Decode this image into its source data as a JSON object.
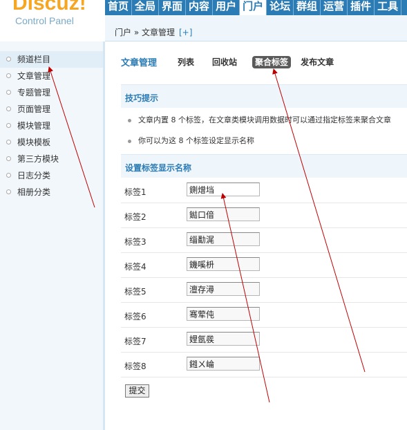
{
  "logo": {
    "brand": "Discuz!",
    "subtitle": "Control Panel"
  },
  "topnav": [
    {
      "label": "首页",
      "active": false
    },
    {
      "label": "全局",
      "active": false
    },
    {
      "label": "界面",
      "active": false
    },
    {
      "label": "内容",
      "active": false
    },
    {
      "label": "用户",
      "active": false
    },
    {
      "label": "门户",
      "active": true
    },
    {
      "label": "论坛",
      "active": false
    },
    {
      "label": "群组",
      "active": false
    },
    {
      "label": "运营",
      "active": false
    },
    {
      "label": "插件",
      "active": false
    },
    {
      "label": "工具",
      "active": false
    }
  ],
  "breadcrumb": {
    "text": "门户 » 文章管理",
    "add": "[+]"
  },
  "sidebar": {
    "items": [
      {
        "label": "频道栏目",
        "active": true
      },
      {
        "label": "文章管理",
        "active": false
      },
      {
        "label": "专题管理",
        "active": false
      },
      {
        "label": "页面管理",
        "active": false
      },
      {
        "label": "模块管理",
        "active": false
      },
      {
        "label": "模块模板",
        "active": false
      },
      {
        "label": "第三方模块",
        "active": false
      },
      {
        "label": "日志分类",
        "active": false
      },
      {
        "label": "相册分类",
        "active": false
      }
    ]
  },
  "subhead": {
    "title": "文章管理",
    "tabs": [
      {
        "label": "列表",
        "active": false
      },
      {
        "label": "回收站",
        "active": false
      },
      {
        "label": "聚合标签",
        "active": true
      },
      {
        "label": "发布文章",
        "active": false
      }
    ]
  },
  "tips": {
    "heading": "技巧提示",
    "items": [
      "文章内置 8 个标签，在文章类模块调用数据时可以通过指定标签来聚合文章",
      "你可以为这 8 个标签设定显示名称"
    ]
  },
  "form": {
    "heading": "设置标签显示名称",
    "rows": [
      {
        "label": "标签1",
        "value": "鍘熷垱"
      },
      {
        "label": "标签2",
        "value": "鐑口偣"
      },
      {
        "label": "标签3",
        "value": "缁勫浘"
      },
      {
        "label": "标签4",
        "value": "鐖嗘枡"
      },
      {
        "label": "标签5",
        "value": "澶存潯"
      },
      {
        "label": "标签6",
        "value": "骞荤伅"
      },
      {
        "label": "标签7",
        "value": "娌氬彂"
      },
      {
        "label": "标签8",
        "value": "鎺ㄨ崘"
      }
    ],
    "submit": "提交"
  },
  "colors": {
    "accent": "#2b7bb4",
    "brand": "#f5a623",
    "annotation": "#c00000"
  }
}
